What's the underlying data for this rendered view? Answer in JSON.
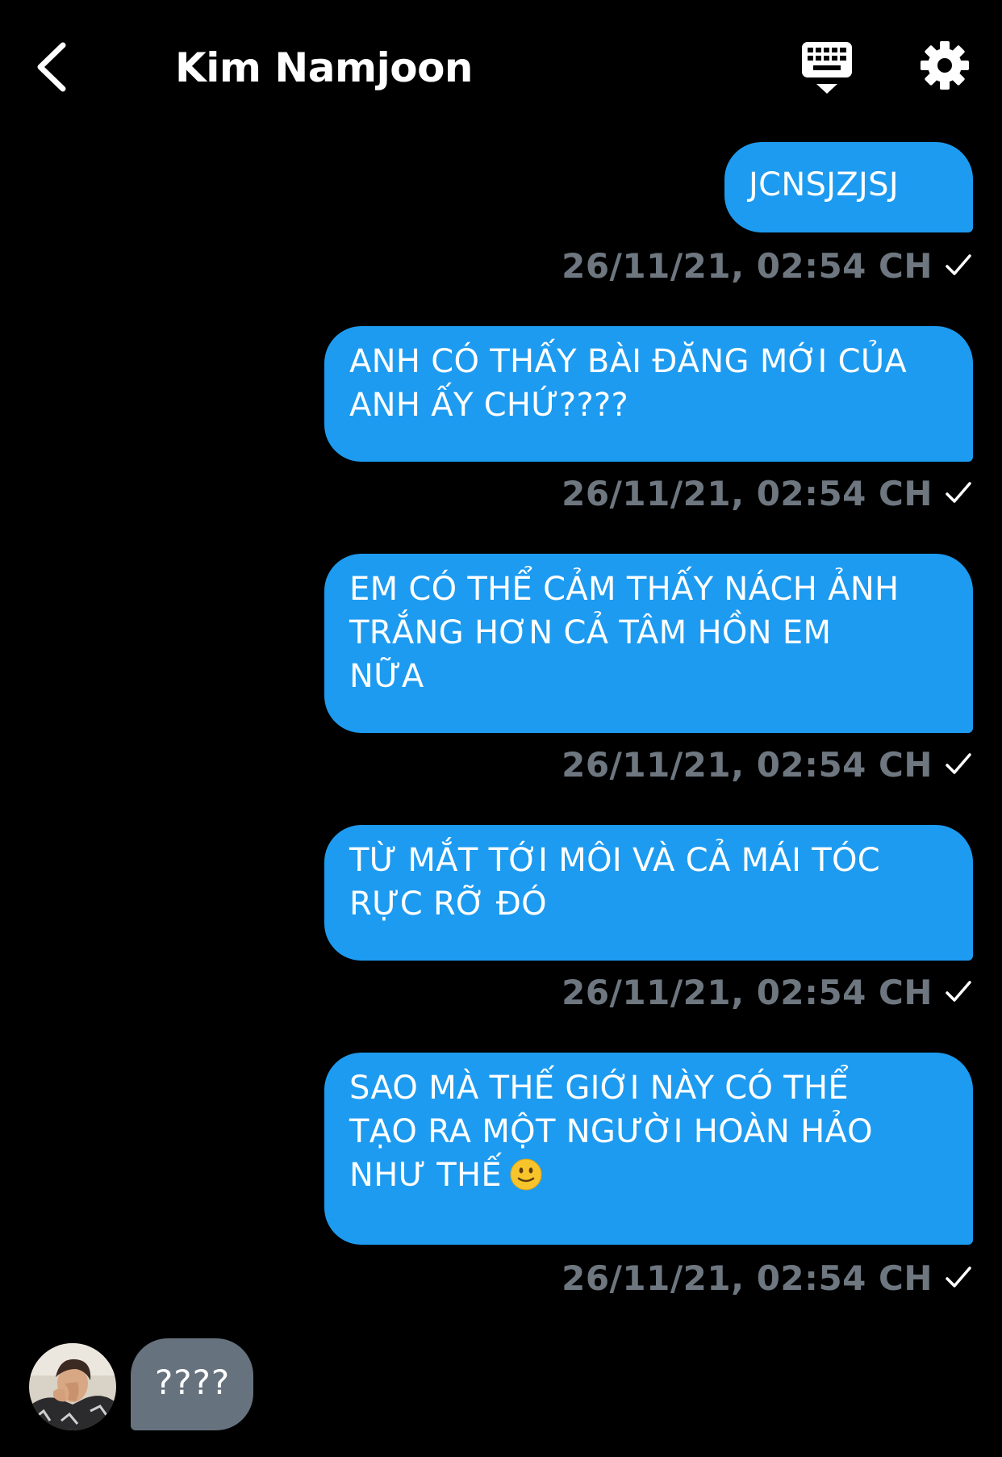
{
  "header": {
    "title": "Kim Namjoon",
    "back_icon": "chevron-left-icon",
    "keyboard_icon": "keyboard-icon",
    "settings_icon": "gear-icon"
  },
  "colors": {
    "background": "#000000",
    "outgoing_bubble": "#1d9bf0",
    "incoming_bubble": "#66727e",
    "timestamp": "#6e7780"
  },
  "messages": [
    {
      "direction": "outgoing",
      "text": "JCNSJZJSJ",
      "timestamp": "26/11/21, 02:54 CH",
      "status_icon": "checkmark-icon"
    },
    {
      "direction": "outgoing",
      "text": "ANH CÓ THẤY BÀI ĐĂNG MỚI CỦA\nANH ẤY CHỨ????",
      "timestamp": "26/11/21, 02:54 CH",
      "status_icon": "checkmark-icon"
    },
    {
      "direction": "outgoing",
      "text": "EM CÓ THỂ CẢM THẤY NÁCH ẢNH\nTRẮNG HƠN CẢ TÂM HỒN EM\nNỮA",
      "timestamp": "26/11/21, 02:54 CH",
      "status_icon": "checkmark-icon"
    },
    {
      "direction": "outgoing",
      "text": "TỪ MẮT TỚI MÔI VÀ CẢ MÁI TÓC\nRỰC RỠ ĐÓ",
      "timestamp": "26/11/21, 02:54 CH",
      "status_icon": "checkmark-icon"
    },
    {
      "direction": "outgoing",
      "text": "SAO MÀ THẾ GIỚI NÀY CÓ THỂ\nTẠO RA MỘT NGƯỜI HOÀN HẢO\nNHƯ THẾ",
      "emoji": "slightly-smiling-face-icon",
      "timestamp": "26/11/21, 02:54 CH",
      "status_icon": "checkmark-icon"
    },
    {
      "direction": "incoming",
      "text": "????",
      "avatar_icon": "avatar"
    }
  ]
}
